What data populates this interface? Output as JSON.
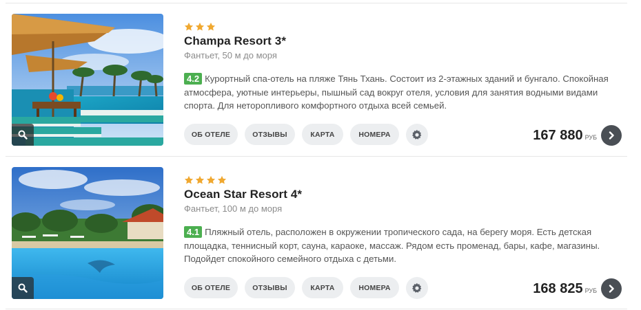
{
  "hotels": [
    {
      "stars": 3,
      "name": "Champa Resort 3*",
      "location": "Фантьет, 50 м до моря",
      "rating": "4.2",
      "description": "Курортный спа-отель на пляже Тянь Тхань. Состоит из 2-этажных зданий и бунгало. Спокойная атмосфера, уютные интерьеры, пышный сад вокруг отеля, условия для занятия водными видами спорта. Для неторопливого комфортного отдыха всей семьей.",
      "buttons": {
        "about": "ОБ ОТЕЛЕ",
        "reviews": "ОТЗЫВЫ",
        "map": "КАРТА",
        "rooms": "НОМЕРА"
      },
      "price": "167 880",
      "currency": "РУБ"
    },
    {
      "stars": 4,
      "name": "Ocean Star Resort 4*",
      "location": "Фантьет, 100 м до моря",
      "rating": "4.1",
      "description": "Пляжный отель, расположен в окружении тропического сада, на берегу моря. Есть детская площадка, теннисный корт, сауна, караоке, массаж. Рядом есть променад, бары, кафе, магазины. Подойдет спокойного семейного отдыха с детьми.",
      "buttons": {
        "about": "ОБ ОТЕЛЕ",
        "reviews": "ОТЗЫВЫ",
        "map": "КАРТА",
        "rooms": "НОМЕРА"
      },
      "price": "168 825",
      "currency": "РУБ"
    }
  ],
  "icons": {
    "zoom": "magnifier-icon",
    "settings": "gear-icon",
    "next": "chevron-right-icon",
    "star": "star-icon"
  },
  "colors": {
    "star": "#f0a830",
    "rating_bg": "#4caf50",
    "button_bg": "#eceef0",
    "go_button_bg": "#4a4f55"
  }
}
